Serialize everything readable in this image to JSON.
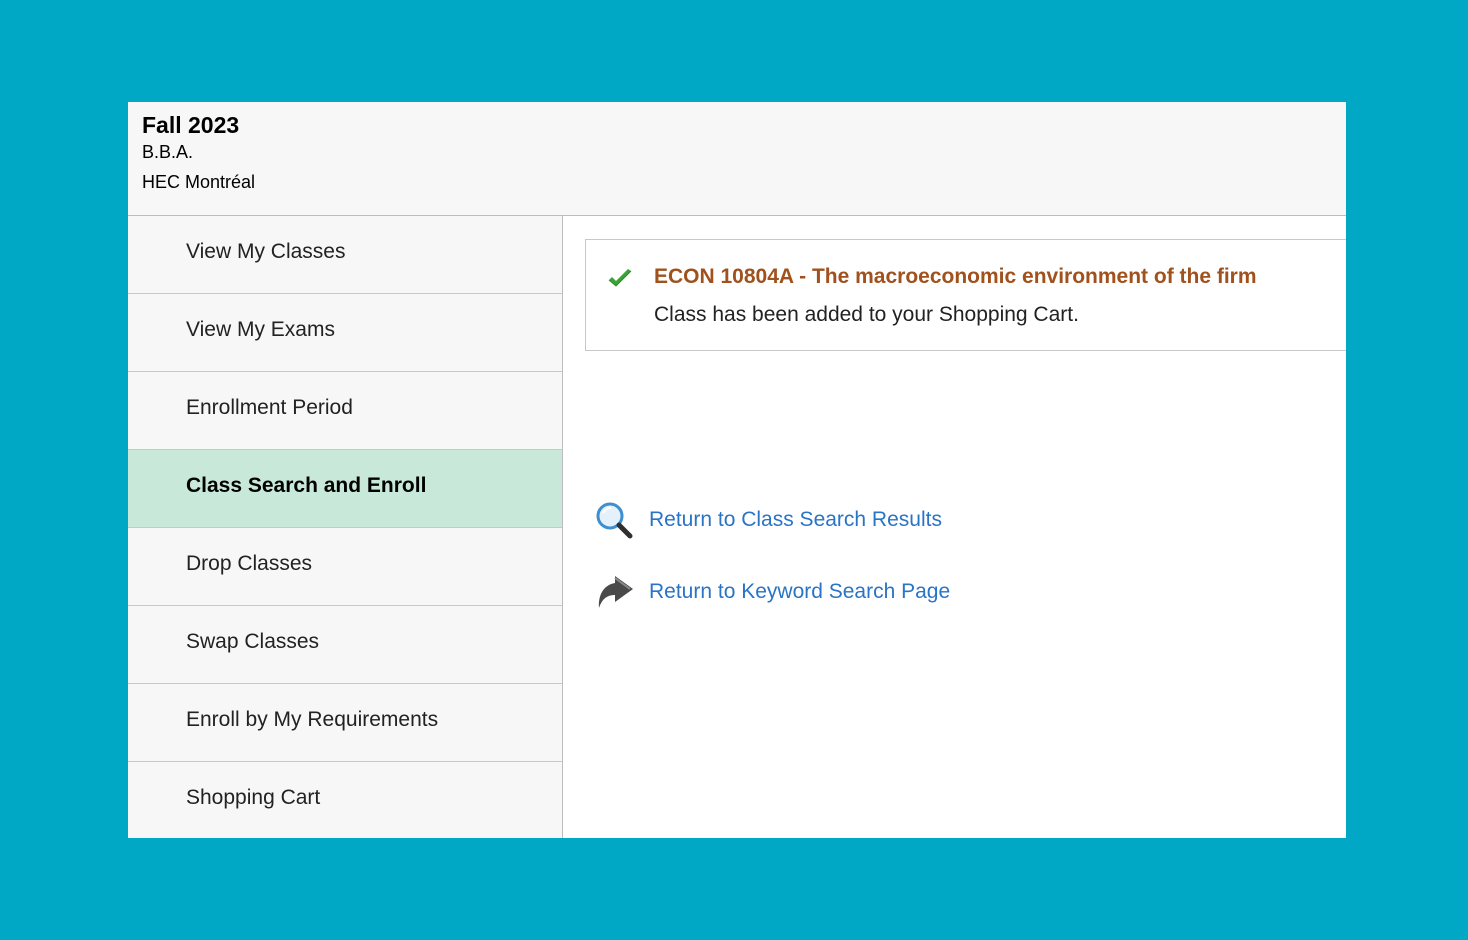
{
  "header": {
    "term": "Fall 2023",
    "career": "B.B.A.",
    "institution": "HEC Montréal"
  },
  "sidebar": {
    "active_index": 3,
    "items": [
      {
        "label": "View My Classes"
      },
      {
        "label": "View My Exams"
      },
      {
        "label": "Enrollment Period"
      },
      {
        "label": "Class Search and Enroll"
      },
      {
        "label": "Drop Classes"
      },
      {
        "label": "Swap Classes"
      },
      {
        "label": "Enroll by My Requirements"
      },
      {
        "label": "Shopping Cart"
      }
    ]
  },
  "message": {
    "icon": "check-icon",
    "title": "ECON 10804A - The macroeconomic environment of the firm",
    "text": "Class has been added to your Shopping Cart."
  },
  "links": [
    {
      "icon": "search-icon",
      "label": "Return to Class Search Results"
    },
    {
      "icon": "return-arrow-icon",
      "label": "Return to Keyword Search Page"
    }
  ],
  "colors": {
    "background": "#00a8c6",
    "active_item": "#c8e9d9",
    "message_title": "#a0511c",
    "link": "#2a74c6",
    "success": "#3aa336"
  }
}
